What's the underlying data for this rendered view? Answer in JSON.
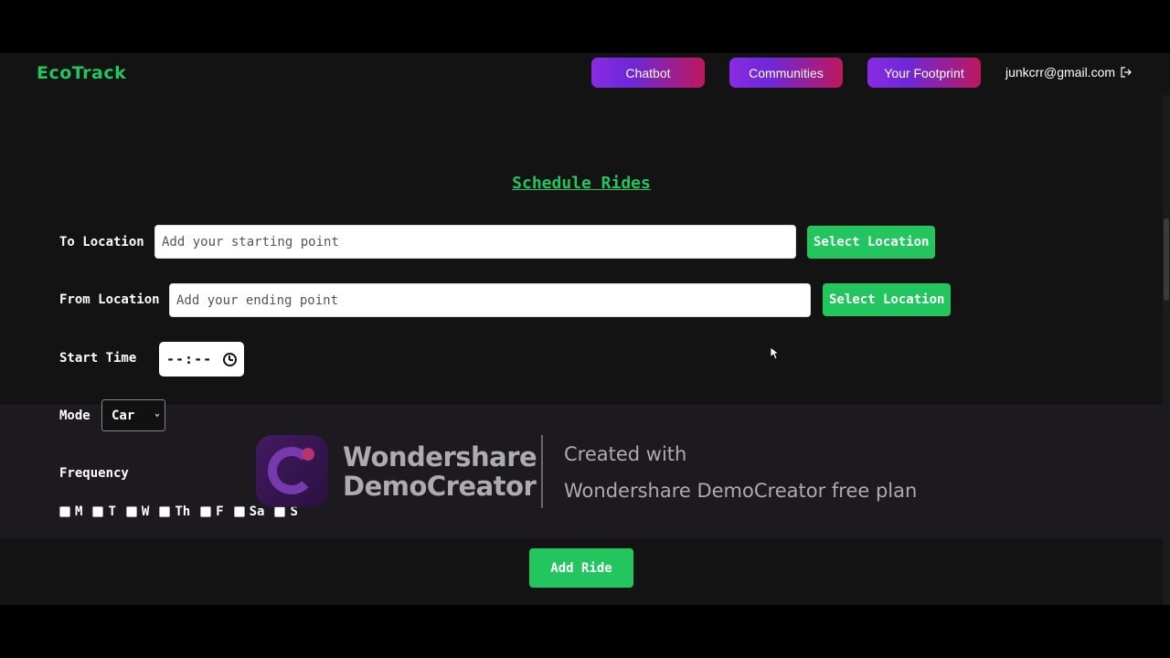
{
  "navbar": {
    "brand": "EcoTrack",
    "links": [
      "Chatbot",
      "Communities",
      "Your Footprint"
    ],
    "user_email": "junkcrr@gmail.com"
  },
  "form": {
    "title": "Schedule Rides",
    "to_label": "To Location",
    "to_placeholder": "Add your starting point",
    "from_label": "From Location",
    "from_placeholder": "Add your ending point",
    "select_location_label": "Select Location",
    "start_time_label": "Start Time",
    "start_time_value": "--:--",
    "mode_label": "Mode",
    "mode_value": "Car",
    "frequency_label": "Frequency",
    "days": [
      "M",
      "T",
      "W",
      "Th",
      "F",
      "Sa",
      "S"
    ],
    "add_button": "Add Ride"
  },
  "watermark": {
    "brand_line1": "Wondershare",
    "brand_line2": "DemoCreator",
    "line1": "Created with",
    "line2": "Wondershare DemoCreator free plan"
  },
  "colors": {
    "accent": "#22c55e",
    "background": "#131313",
    "nav_gradient_start": "#8a2be2",
    "nav_gradient_end": "#be185d"
  }
}
